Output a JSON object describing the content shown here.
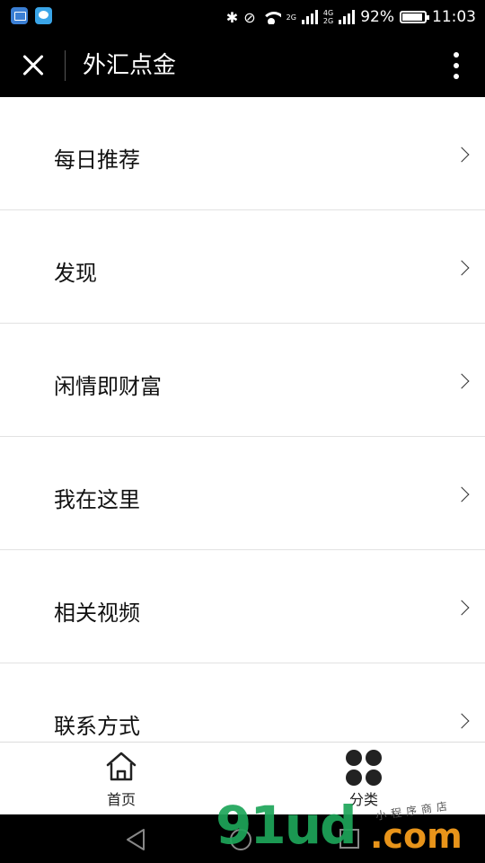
{
  "status_bar": {
    "net_tag_1": "2G",
    "net_tag_2a": "4G",
    "net_tag_2b": "2G",
    "battery_percent": "92%",
    "battery_level": 0.92,
    "time": "11:03",
    "icons": [
      "gallery-icon",
      "message-icon",
      "bluetooth-icon",
      "mute-icon",
      "wifi-icon",
      "signal-icon",
      "battery-icon"
    ]
  },
  "header": {
    "title": "外汇点金",
    "close_icon": "close-icon",
    "more_icon": "more-icon"
  },
  "menu": {
    "items": [
      {
        "label": "每日推荐"
      },
      {
        "label": "发现"
      },
      {
        "label": "闲情即财富"
      },
      {
        "label": "我在这里"
      },
      {
        "label": "相关视频"
      },
      {
        "label": "联系方式"
      }
    ]
  },
  "tabbar": {
    "home_label": "首页",
    "category_label": "分类",
    "active": "category"
  },
  "watermark": {
    "brand": "91ud",
    "domain": ".com",
    "tagline": "小程序商店"
  },
  "colors": {
    "header_bg": "#000000",
    "divider": "#e2e2e2",
    "watermark_green": "#1ea55a",
    "watermark_orange": "#e8941a"
  }
}
